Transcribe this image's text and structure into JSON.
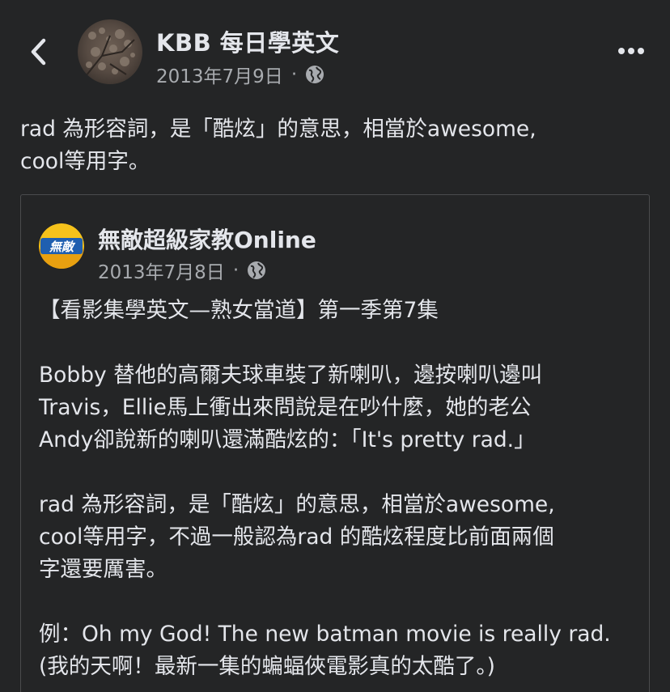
{
  "header": {
    "page_name": "KBB 每日學英文",
    "date": "2013年7月9日",
    "separator": "·"
  },
  "icons": {
    "back": "chevron-left-icon",
    "privacy": "globe-icon",
    "more": "more-dots-icon"
  },
  "post": {
    "lines": [
      "rad 為形容詞，是「酷炫」的意思，相當於awesome,",
      "cool等用字。"
    ]
  },
  "shared": {
    "page_name": "無敵超級家教Online",
    "avatar_text": "無敵",
    "date": "2013年7月8日",
    "separator": "·",
    "lines": [
      "【看影集學英文—熟女當道】第一季第7集",
      "",
      "Bobby 替他的高爾夫球車裝了新喇叭，邊按喇叭邊叫",
      "Travis，Ellie馬上衝出來問說是在吵什麼，她的老公",
      "Andy卻說新的喇叭還滿酷炫的：「It's pretty rad.」",
      "",
      "rad 為形容詞，是「酷炫」的意思，相當於awesome,",
      "cool等用字，不過一般認為rad 的酷炫程度比前面兩個",
      "字還要厲害。",
      "",
      "例：Oh my God! The new batman movie is really rad.",
      "(我的天啊！最新一集的蝙蝠俠電影真的太酷了。)"
    ]
  },
  "colors": {
    "background": "#242526",
    "text_primary": "#e4e6eb",
    "text_secondary": "#a8abaf",
    "card_border": "#4a4b4d",
    "logo_yellow": "#f5c21b",
    "logo_blue": "#1f5fb0"
  }
}
